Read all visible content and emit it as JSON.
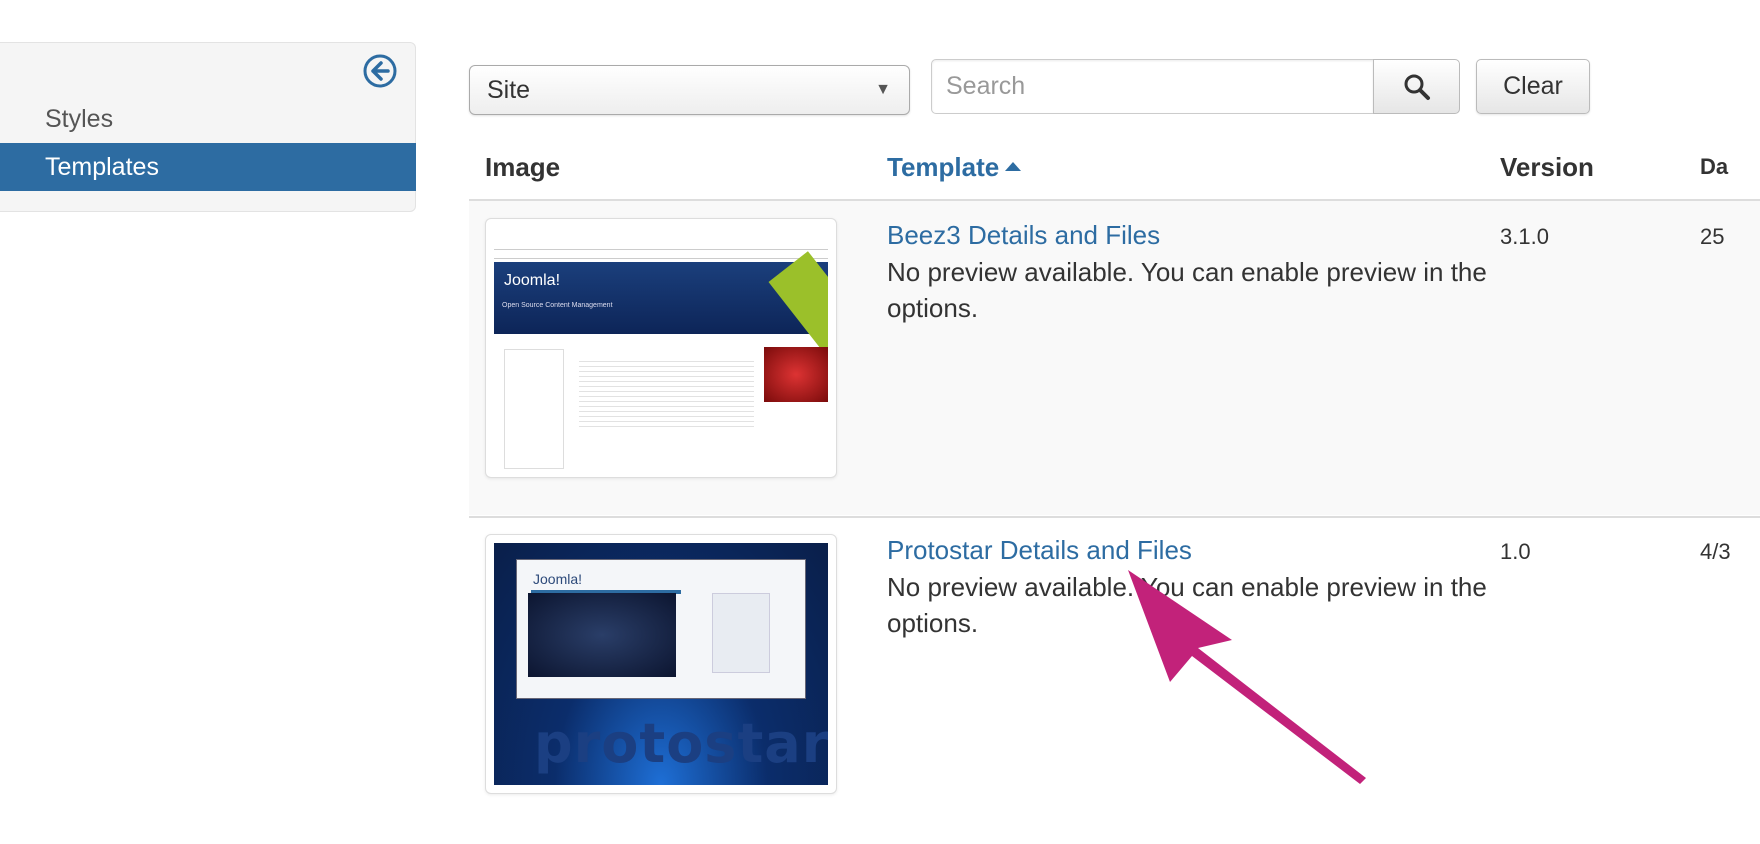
{
  "sidebar": {
    "items": [
      {
        "label": "Styles",
        "active": false
      },
      {
        "label": "Templates",
        "active": true
      }
    ]
  },
  "filters": {
    "client_select": "Site",
    "search_placeholder": "Search",
    "clear_label": "Clear"
  },
  "table": {
    "columns": {
      "image": "Image",
      "template": "Template",
      "version": "Version",
      "date": "Da"
    },
    "rows": [
      {
        "name": "Beez3 Details and Files",
        "description": "No preview available. You can enable preview in the options.",
        "version": "3.1.0",
        "date": "25",
        "thumb": {
          "banner_title": "Joomla!",
          "banner_sub": "Open Source Content Management"
        }
      },
      {
        "name": "Protostar Details and Files",
        "description": "No preview available. You can enable preview in the options.",
        "version": "1.0",
        "date": "4/3",
        "thumb": {
          "logo_text": "Joomla!",
          "word": "protostar"
        }
      }
    ]
  },
  "colors": {
    "accent": "#2d6ca2",
    "arrow": "#c2227a"
  },
  "icons": {
    "collapse": "circle-arrow-left-icon",
    "search": "search-icon",
    "sort": "sort-up-icon",
    "select": "chevron-down-icon"
  }
}
